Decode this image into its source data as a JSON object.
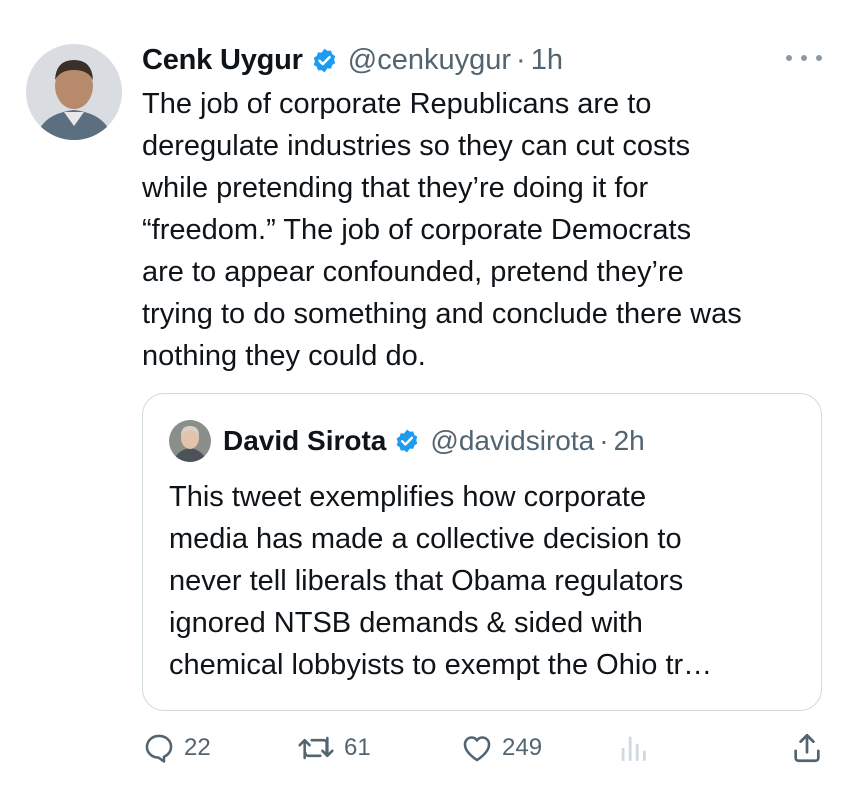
{
  "tweet": {
    "author_name": "Cenk Uygur",
    "handle": "@cenkuygur",
    "separator": "·",
    "time": "1h",
    "text": "The job of corporate Republicans are to\nderegulate industries so they can cut costs\nwhile pretending that they’re doing it for\n“freedom.” The job of corporate Democrats\nare to appear confounded, pretend they’re\ntrying to do something and conclude there was\nnothing they could do."
  },
  "quoted": {
    "author_name": "David Sirota",
    "handle": "@davidsirota",
    "separator": "·",
    "time": "2h",
    "text": "This tweet exemplifies how corporate\nmedia has made a collective decision to\nnever tell liberals that Obama regulators\nignored NTSB demands & sided with\nchemical lobbyists to exempt the Ohio tr…"
  },
  "actions": {
    "replies": "22",
    "retweets": "61",
    "likes": "249"
  },
  "icons": [
    "verified-badge-icon",
    "more-icon",
    "reply-icon",
    "retweet-icon",
    "like-icon",
    "views-icon",
    "share-icon"
  ],
  "colors": {
    "verified": "#1d9bf0",
    "secondary_text": "#536471",
    "border": "#cfd9de"
  }
}
